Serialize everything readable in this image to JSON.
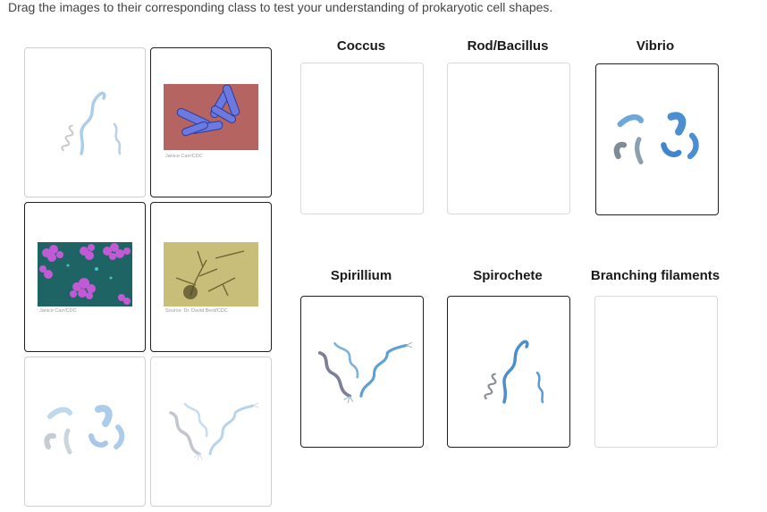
{
  "instructions": "Drag the images to their corresponding class to test your understanding of prokaryotic cell shapes.",
  "source_cards": [
    {
      "name": "spirochete-image",
      "credit": "",
      "state": "ghost"
    },
    {
      "name": "bacillus-photo",
      "credit": "Janice Carr/CDC",
      "state": "filled"
    },
    {
      "name": "coccus-photo",
      "credit": "Janice Carr/CDC",
      "state": "filled"
    },
    {
      "name": "branching-filaments-photo",
      "credit": "Source: Dr. David Berd/CDC",
      "state": "filled"
    },
    {
      "name": "vibrio-image",
      "credit": "",
      "state": "ghost"
    },
    {
      "name": "spirillium-image",
      "credit": "",
      "state": "ghost"
    }
  ],
  "classes": [
    {
      "label": "Coccus",
      "occupied": false
    },
    {
      "label": "Rod/Bacillus",
      "occupied": false
    },
    {
      "label": "Vibrio",
      "occupied": true,
      "content": "vibrio-image"
    },
    {
      "label": "Spirillium",
      "occupied": true,
      "content": "spirillium-image"
    },
    {
      "label": "Spirochete",
      "occupied": true,
      "content": "spirochete-image"
    },
    {
      "label": "Branching filaments",
      "occupied": false
    }
  ]
}
